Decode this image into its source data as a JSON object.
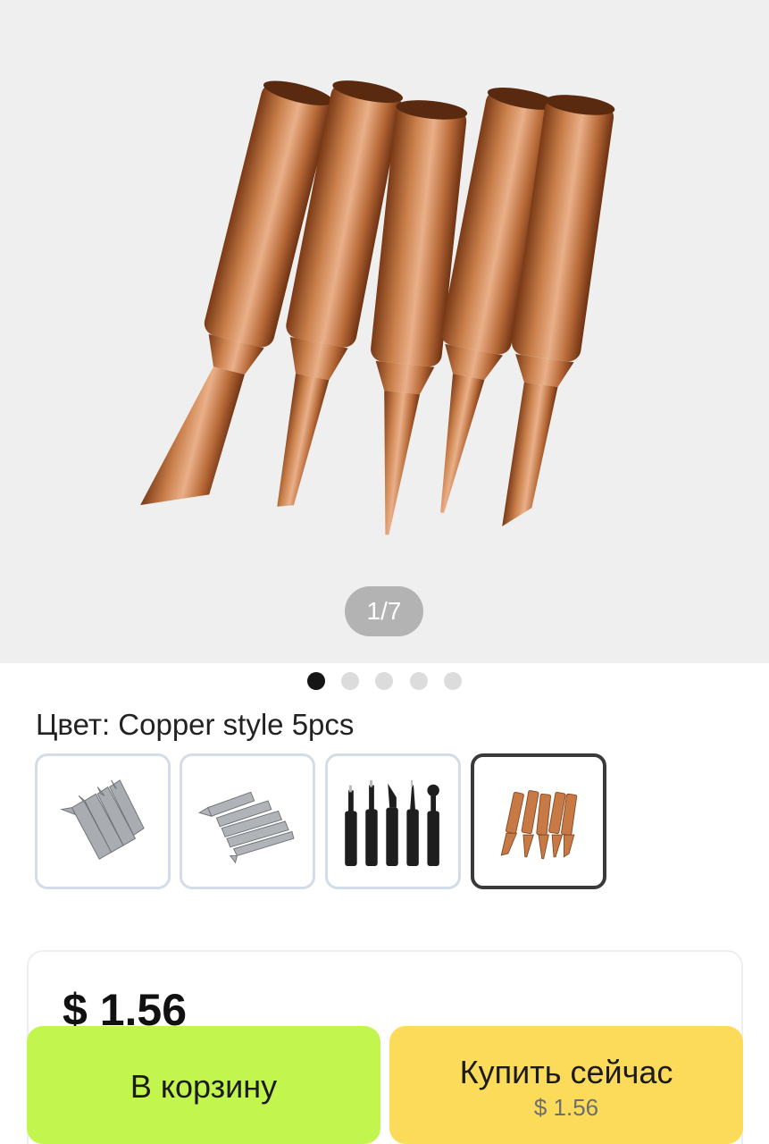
{
  "gallery": {
    "counter": "1/7",
    "dot_count": 5,
    "active_dot": 0
  },
  "variant": {
    "label": "Цвет: Copper style 5pcs",
    "options": [
      {
        "name": "silver-tips-set-a",
        "selected": false
      },
      {
        "name": "silver-tips-set-b",
        "selected": false
      },
      {
        "name": "black-tips-set",
        "selected": false
      },
      {
        "name": "copper-tips-set",
        "selected": true
      }
    ]
  },
  "price": {
    "amount": "$ 1.56"
  },
  "actions": {
    "add_to_cart_label": "В корзину",
    "buy_now_label": "Купить сейчас",
    "buy_now_price": "$ 1.56"
  },
  "colors": {
    "cart_button": "#c3f54f",
    "buy_button": "#fddb5a",
    "copper": "#c77a45"
  }
}
